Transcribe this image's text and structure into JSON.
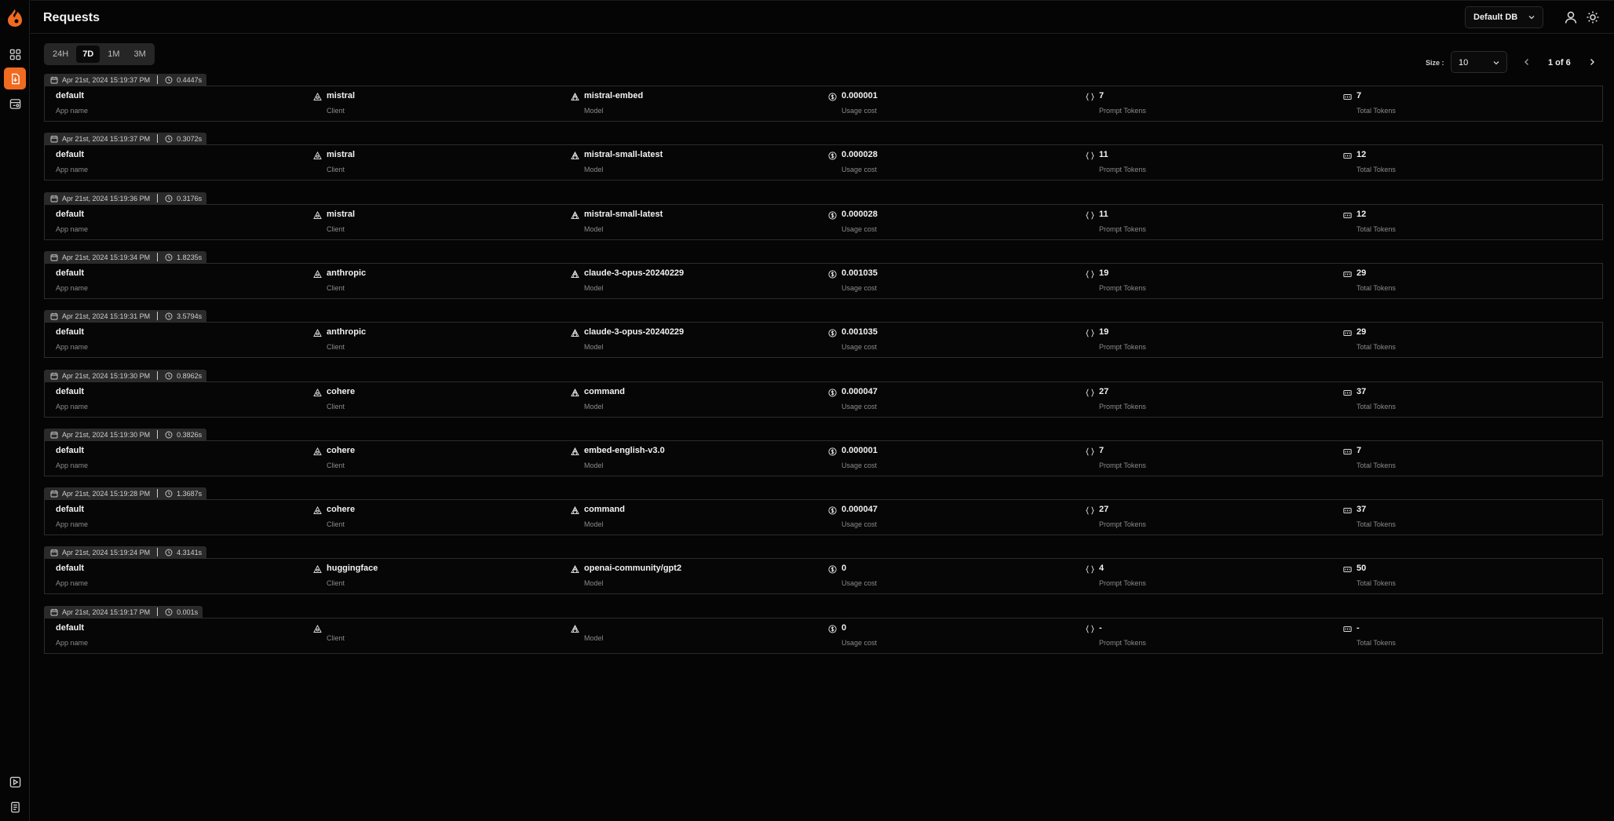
{
  "page_title": "Requests",
  "header": {
    "db_select": "Default DB"
  },
  "range_tabs": [
    {
      "label": "24H",
      "selected": false
    },
    {
      "label": "7D",
      "selected": true
    },
    {
      "label": "1M",
      "selected": false
    },
    {
      "label": "3M",
      "selected": false
    }
  ],
  "pagination": {
    "size_label": "Size :",
    "size_value": "10",
    "page_text": "1 of 6"
  },
  "labels": {
    "app": "App name",
    "client": "Client",
    "model": "Model",
    "cost": "Usage cost",
    "prompt": "Prompt Tokens",
    "total": "Total Tokens"
  },
  "requests": [
    {
      "date": "Apr 21st, 2024 15:19:37 PM",
      "duration": "0.4447s",
      "app": "default",
      "client": "mistral",
      "model": "mistral-embed",
      "cost": "0.000001",
      "prompt": "7",
      "total": "7"
    },
    {
      "date": "Apr 21st, 2024 15:19:37 PM",
      "duration": "0.3072s",
      "app": "default",
      "client": "mistral",
      "model": "mistral-small-latest",
      "cost": "0.000028",
      "prompt": "11",
      "total": "12"
    },
    {
      "date": "Apr 21st, 2024 15:19:36 PM",
      "duration": "0.3176s",
      "app": "default",
      "client": "mistral",
      "model": "mistral-small-latest",
      "cost": "0.000028",
      "prompt": "11",
      "total": "12"
    },
    {
      "date": "Apr 21st, 2024 15:19:34 PM",
      "duration": "1.8235s",
      "app": "default",
      "client": "anthropic",
      "model": "claude-3-opus-20240229",
      "cost": "0.001035",
      "prompt": "19",
      "total": "29"
    },
    {
      "date": "Apr 21st, 2024 15:19:31 PM",
      "duration": "3.5794s",
      "app": "default",
      "client": "anthropic",
      "model": "claude-3-opus-20240229",
      "cost": "0.001035",
      "prompt": "19",
      "total": "29"
    },
    {
      "date": "Apr 21st, 2024 15:19:30 PM",
      "duration": "0.8962s",
      "app": "default",
      "client": "cohere",
      "model": "command",
      "cost": "0.000047",
      "prompt": "27",
      "total": "37"
    },
    {
      "date": "Apr 21st, 2024 15:19:30 PM",
      "duration": "0.3826s",
      "app": "default",
      "client": "cohere",
      "model": "embed-english-v3.0",
      "cost": "0.000001",
      "prompt": "7",
      "total": "7"
    },
    {
      "date": "Apr 21st, 2024 15:19:28 PM",
      "duration": "1.3687s",
      "app": "default",
      "client": "cohere",
      "model": "command",
      "cost": "0.000047",
      "prompt": "27",
      "total": "37"
    },
    {
      "date": "Apr 21st, 2024 15:19:24 PM",
      "duration": "4.3141s",
      "app": "default",
      "client": "huggingface",
      "model": "openai-community/gpt2",
      "cost": "0",
      "prompt": "4",
      "total": "50"
    },
    {
      "date": "Apr 21st, 2024 15:19:17 PM",
      "duration": "0.001s",
      "app": "default",
      "client": "",
      "model": "",
      "cost": "0",
      "prompt": "-",
      "total": "-"
    }
  ],
  "icons": {
    "logo": "flame-logo-icon",
    "nav": [
      "dashboard-icon",
      "requests-icon",
      "database-icon"
    ],
    "nav_bottom": [
      "playground-icon",
      "docs-icon"
    ],
    "header": [
      "user-icon",
      "sun-icon"
    ]
  },
  "colors": {
    "accent": "#f06a1f",
    "background": "#050505",
    "border": "#2c2c2c",
    "meta_bg": "#2a2a2a"
  }
}
